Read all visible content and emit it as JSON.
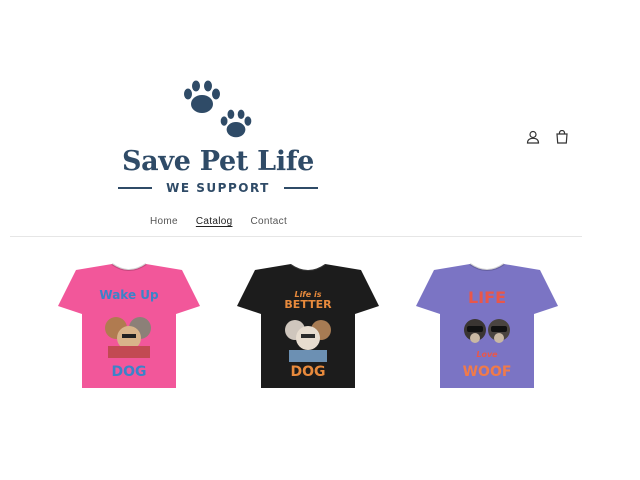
{
  "brand": {
    "title": "Save Pet Life",
    "subtitle": "WE SUPPORT",
    "color": "#2f4b67"
  },
  "header_icons": {
    "account": "user-icon",
    "cart": "shopping-bag-icon"
  },
  "nav": {
    "items": [
      {
        "label": "Home",
        "active": false
      },
      {
        "label": "Catalog",
        "active": true
      },
      {
        "label": "Contact",
        "active": false
      }
    ]
  },
  "products": [
    {
      "shirt_color": "#f2579a",
      "print_top": "Wake Up",
      "print_mid": "",
      "print_bottom": "DOG",
      "top_color": "#3b83c9",
      "bottom_color": "#3b83c9"
    },
    {
      "shirt_color": "#1c1c1c",
      "print_top": "BETTER",
      "print_mid": "Life is",
      "print_bottom": "DOG",
      "top_color": "#e88a3c",
      "bottom_color": "#e88a3c"
    },
    {
      "shirt_color": "#7b74c4",
      "print_top": "LIFE",
      "print_mid": "Love",
      "print_bottom": "WOOF",
      "top_color": "#e9574a",
      "bottom_color": "#f07a4a"
    }
  ]
}
